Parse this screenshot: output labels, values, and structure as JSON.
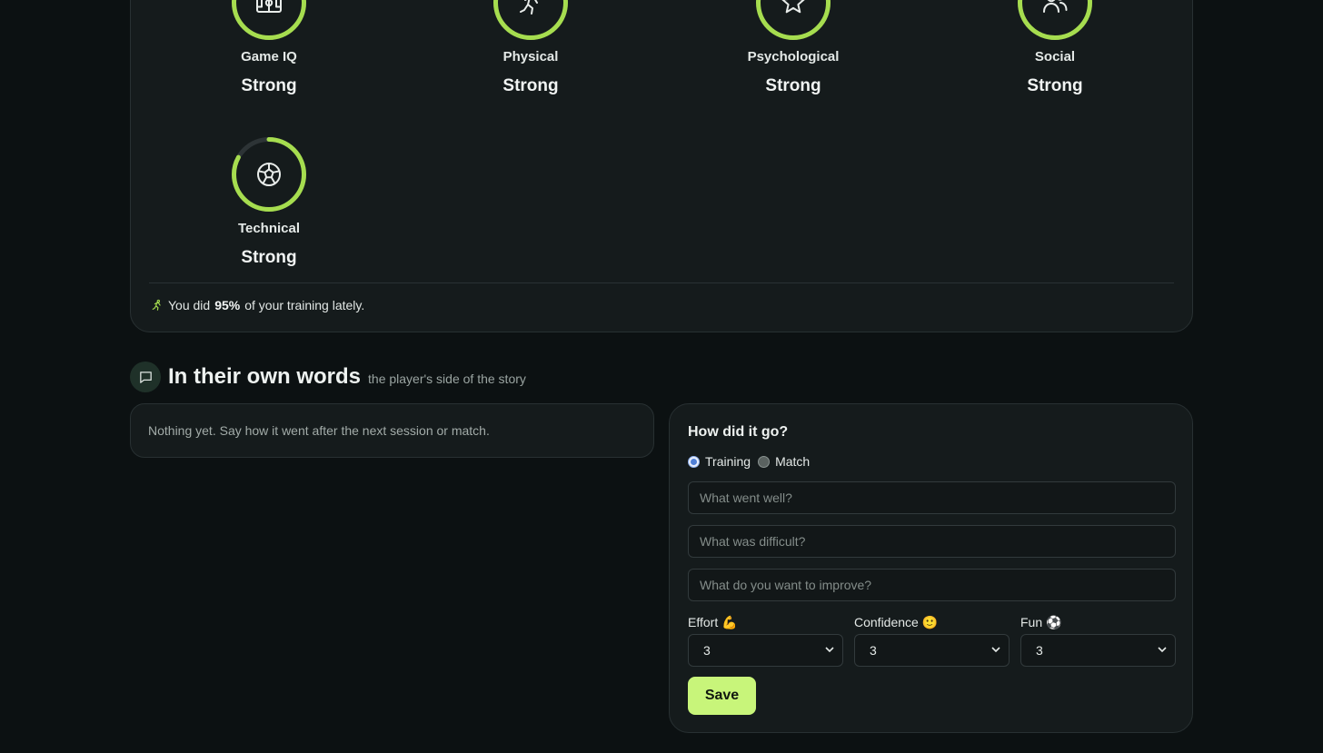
{
  "metrics": [
    {
      "label": "Game IQ",
      "value": "Strong",
      "icon": "field-icon",
      "progress": 1.0
    },
    {
      "label": "Physical",
      "value": "Strong",
      "icon": "runner-icon",
      "progress": 1.0
    },
    {
      "label": "Psychological",
      "value": "Strong",
      "icon": "star-icon",
      "progress": 1.0
    },
    {
      "label": "Social",
      "value": "Strong",
      "icon": "people-icon",
      "progress": 1.0
    },
    {
      "label": "Technical",
      "value": "Strong",
      "icon": "soccer-ball-icon",
      "progress": 0.83
    }
  ],
  "training_note": {
    "prefix": "You did",
    "percent": "95%",
    "suffix": "of your training lately."
  },
  "section": {
    "title": "In their own words",
    "subtitle": "the player's side of the story"
  },
  "empty_state": "Nothing yet. Say how it went after the next session or match.",
  "form": {
    "title": "How did it go?",
    "types": [
      "Training",
      "Match"
    ],
    "selected_type": "Training",
    "went_well_placeholder": "What went well?",
    "difficult_placeholder": "What was difficult?",
    "improve_placeholder": "What do you want to improve?",
    "ratings": [
      {
        "label": "Effort",
        "emoji": "💪",
        "value": "3"
      },
      {
        "label": "Confidence",
        "emoji": "🙂",
        "value": "3"
      },
      {
        "label": "Fun",
        "emoji": "⚽",
        "value": "3"
      }
    ],
    "save_label": "Save"
  },
  "colors": {
    "accent": "#a6dd4f",
    "ring_track": "#2d3436",
    "button": "#c8f57a",
    "background": "#0c1112",
    "card": "#151b1c"
  }
}
